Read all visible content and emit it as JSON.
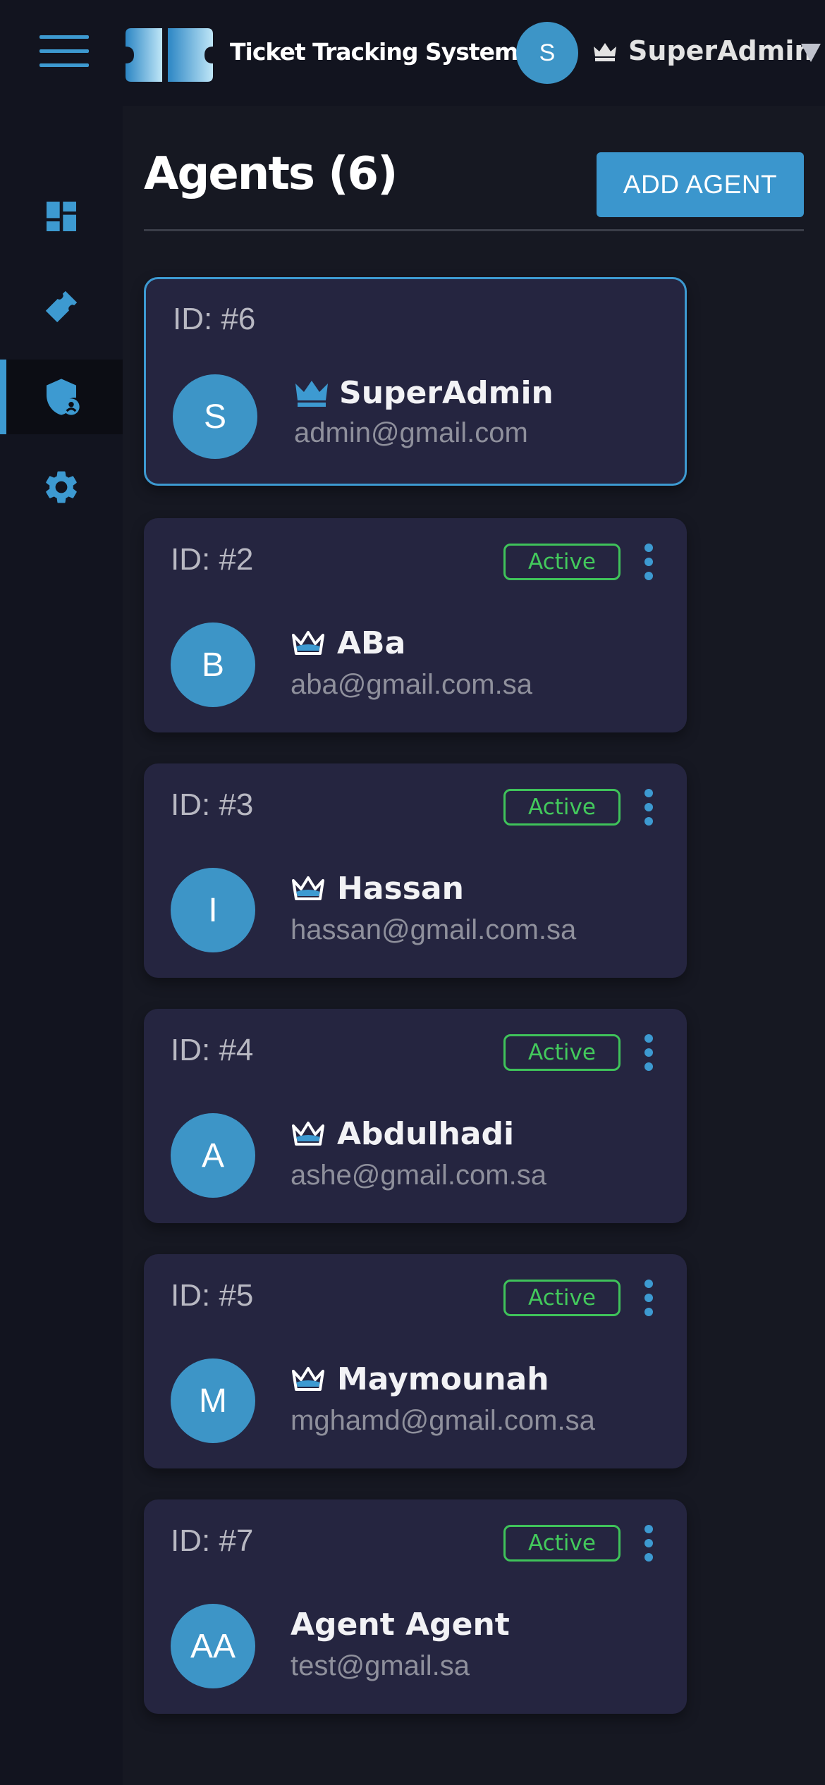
{
  "header": {
    "app_title": "Ticket Tracking System",
    "user": {
      "initial": "S",
      "name": "SuperAdmin"
    }
  },
  "sidebar": {
    "items": [
      {
        "icon": "dashboard-icon"
      },
      {
        "icon": "ticket-icon"
      },
      {
        "icon": "agents-shield-icon",
        "active": true
      },
      {
        "icon": "settings-gear-icon"
      }
    ]
  },
  "main": {
    "title": "Agents (6)",
    "add_button": "ADD AGENT",
    "agents": [
      {
        "id": "ID: #6",
        "initials": "S",
        "name": "SuperAdmin",
        "email": "admin@gmail.com",
        "role_icon": "crown-filled-icon",
        "selected": true
      },
      {
        "id": "ID: #2",
        "status": "Active",
        "initials": "B",
        "name": "ABa",
        "email": "aba@gmail.com.sa",
        "role_icon": "crown-outline-icon"
      },
      {
        "id": "ID: #3",
        "status": "Active",
        "initials": "I",
        "name": "Hassan",
        "email": "hassan@gmail.com.sa",
        "role_icon": "crown-outline-icon"
      },
      {
        "id": "ID: #4",
        "status": "Active",
        "initials": "A",
        "name": "Abdulhadi",
        "email": "ashe@gmail.com.sa",
        "role_icon": "crown-outline-icon"
      },
      {
        "id": "ID: #5",
        "status": "Active",
        "initials": "M",
        "name": "Maymounah",
        "email": "mghamd@gmail.com.sa",
        "role_icon": "crown-outline-icon"
      },
      {
        "id": "ID: #7",
        "status": "Active",
        "initials": "AA",
        "name": "Agent Agent",
        "email": "test@gmail.sa"
      }
    ]
  },
  "colors": {
    "accent": "#3d9ad1",
    "active_status": "#43c95c",
    "card_bg": "#252540",
    "page_bg": "#12141f"
  }
}
